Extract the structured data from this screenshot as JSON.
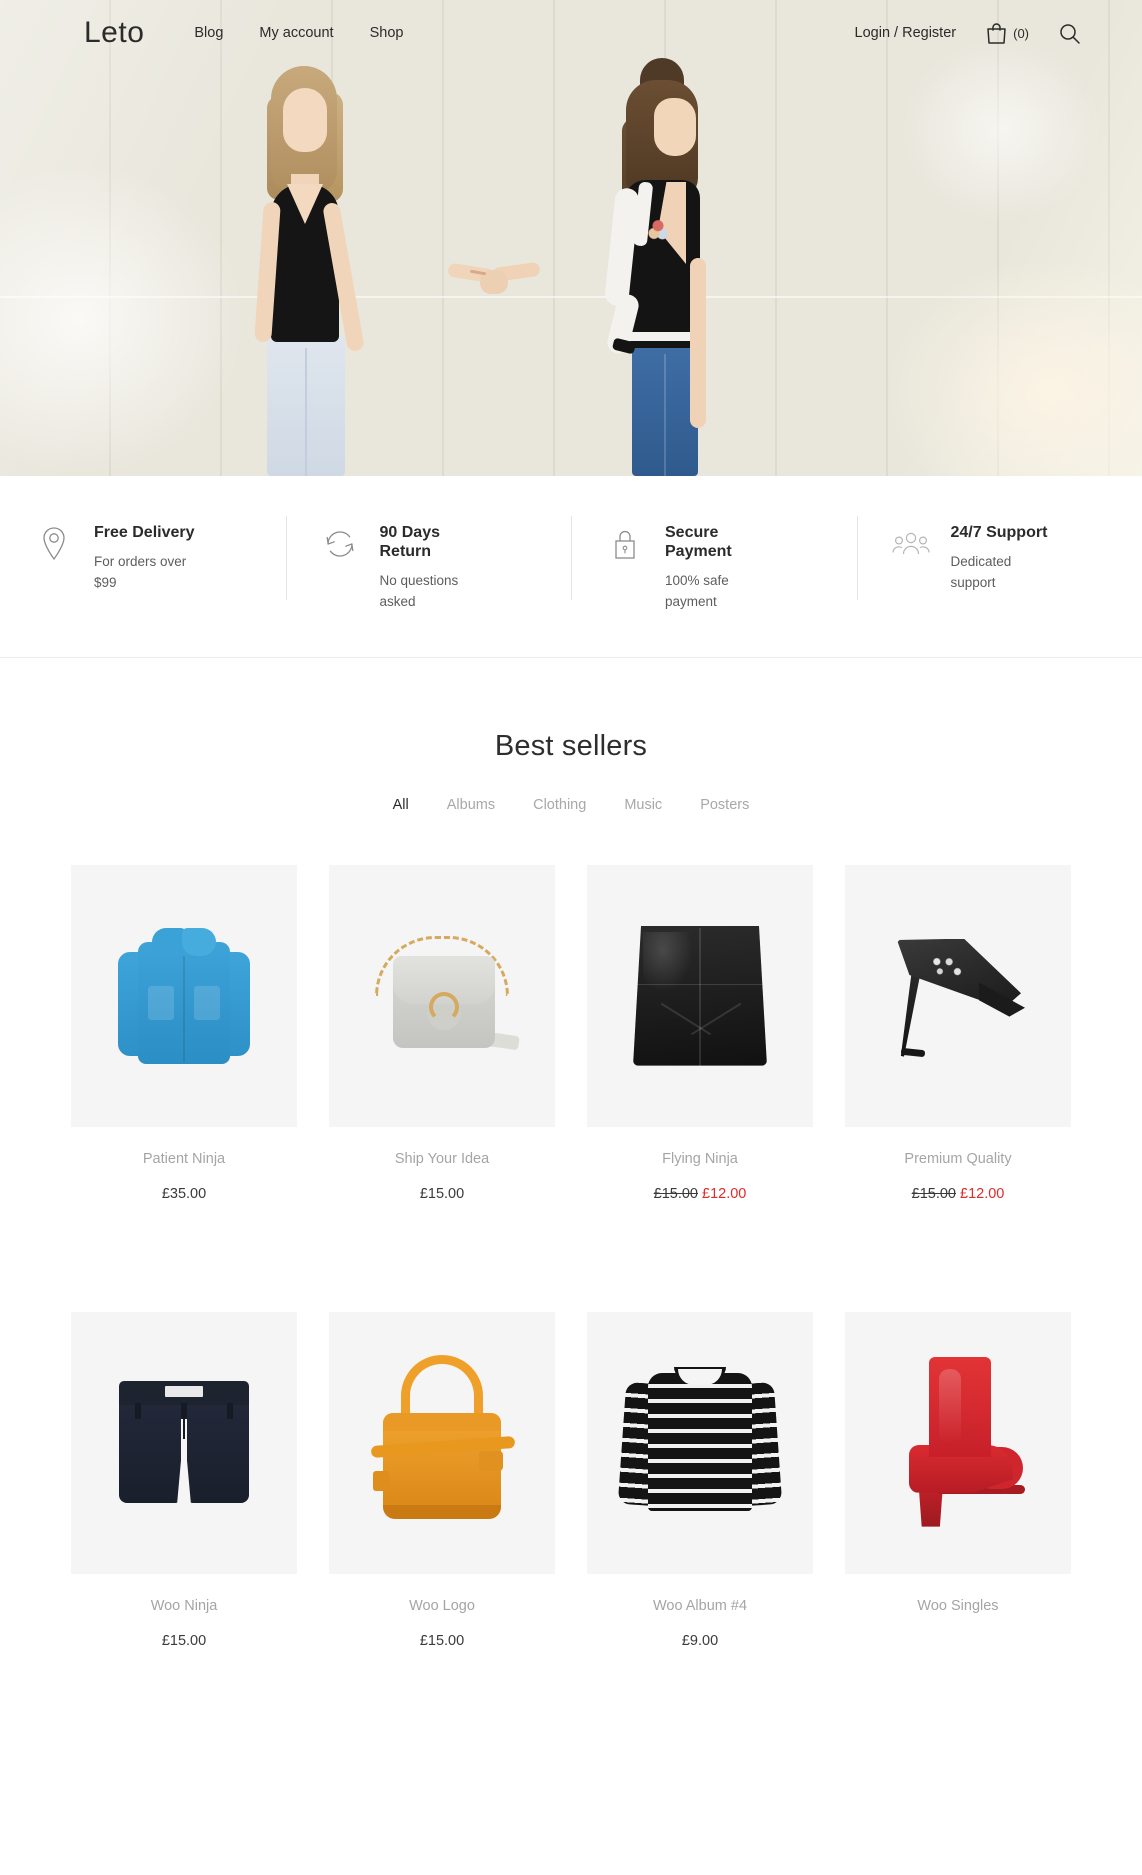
{
  "header": {
    "logo": "Leto",
    "nav": [
      {
        "label": "Blog"
      },
      {
        "label": "My account"
      },
      {
        "label": "Shop"
      }
    ],
    "login_label": "Login / Register",
    "cart_count": "(0)",
    "cart_icon": "shopping-bag-icon",
    "search_icon": "search-icon"
  },
  "hero": {
    "alt": "Two women holding hands in front of a tiled wall"
  },
  "features": [
    {
      "icon": "location-pin-icon",
      "title": "Free Delivery",
      "subtitle": "For orders over $99"
    },
    {
      "icon": "refresh-cycle-icon",
      "title": "90 Days Return",
      "subtitle": "No questions asked"
    },
    {
      "icon": "lock-icon",
      "title": "Secure Payment",
      "subtitle": "100% safe payment"
    },
    {
      "icon": "people-group-icon",
      "title": "24/7 Support",
      "subtitle": "Dedicated support"
    }
  ],
  "best_sellers": {
    "title": "Best sellers",
    "tabs": [
      {
        "label": "All",
        "active": true
      },
      {
        "label": "Albums",
        "active": false
      },
      {
        "label": "Clothing",
        "active": false
      },
      {
        "label": "Music",
        "active": false
      },
      {
        "label": "Posters",
        "active": false
      }
    ],
    "products": [
      {
        "name": "Patient Ninja",
        "price": "£35.00",
        "old_price": "",
        "sale_price": "",
        "art": "coat"
      },
      {
        "name": "Ship Your Idea",
        "price": "£15.00",
        "old_price": "",
        "sale_price": "",
        "art": "bag1"
      },
      {
        "name": "Flying Ninja",
        "price": "",
        "old_price": "£15.00",
        "sale_price": "£12.00",
        "art": "skirt"
      },
      {
        "name": "Premium Quality",
        "price": "",
        "old_price": "£15.00",
        "sale_price": "£12.00",
        "art": "heel1"
      },
      {
        "name": "Woo Ninja",
        "price": "£15.00",
        "old_price": "",
        "sale_price": "",
        "art": "shorts"
      },
      {
        "name": "Woo Logo",
        "price": "£15.00",
        "old_price": "",
        "sale_price": "",
        "art": "bag2"
      },
      {
        "name": "Woo Album #4",
        "price": "£9.00",
        "old_price": "",
        "sale_price": "",
        "art": "sweater"
      },
      {
        "name": "Woo Singles",
        "price": "",
        "old_price": "",
        "sale_price": "",
        "art": "boot"
      }
    ]
  },
  "colors": {
    "sale_red": "#e02b2b",
    "text_dark": "#2b2b2b",
    "text_muted": "#a5a5a5",
    "hero_bg": "#e7e4d8",
    "tile_bg": "#f5f5f5"
  }
}
